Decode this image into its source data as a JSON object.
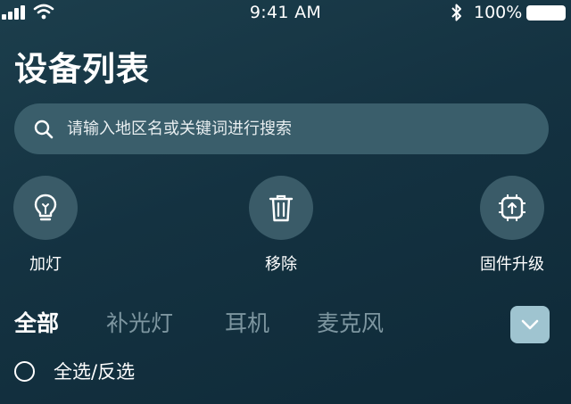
{
  "status_bar": {
    "time": "9:41 AM",
    "battery_percent": "100%",
    "icons": [
      "signal-icon",
      "wifi-icon",
      "bluetooth-icon",
      "battery-icon"
    ]
  },
  "header": {
    "title": "设备列表"
  },
  "search": {
    "placeholder": "请输入地区名或关键词进行搜索",
    "value": ""
  },
  "actions": [
    {
      "label": "加灯",
      "icon": "lightbulb-icon"
    },
    {
      "label": "移除",
      "icon": "trash-icon"
    },
    {
      "label": "固件升级",
      "icon": "firmware-upgrade-icon"
    }
  ],
  "tabs": [
    {
      "label": "全部",
      "active": true
    },
    {
      "label": "补光灯",
      "active": false
    },
    {
      "label": "耳机",
      "active": false
    },
    {
      "label": "麦克风",
      "active": false
    }
  ],
  "select_all": {
    "label": "全选/反选",
    "checked": false
  },
  "colors": {
    "background": "#143241",
    "search_bg": "#3a5e6b",
    "action_circle": "#3a5b68",
    "tab_inactive": "#7d96a0",
    "dropdown_bg": "#9fc4d0"
  }
}
